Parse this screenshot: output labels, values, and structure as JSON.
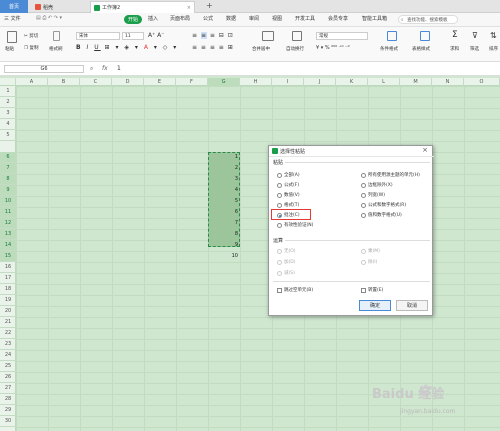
{
  "tabs": {
    "home": "首页",
    "doc": "稻壳",
    "book": "工作簿2"
  },
  "menu": {
    "file": "三 文件",
    "items": [
      "开始",
      "插入",
      "页面布局",
      "公式",
      "数据",
      "审阅",
      "视图",
      "开发工具",
      "会员专享",
      "智能工具箱"
    ],
    "search": "查找功能、搜索模板"
  },
  "toolbar": {
    "paste": "粘贴",
    "cut": "剪切",
    "copy": "复制",
    "format_painter": "格式刷",
    "font_name": "宋体",
    "font_size": "11",
    "merge": "合并居中",
    "wrap": "自动换行",
    "number_format": "常规",
    "cond_format": "条件格式",
    "table_style": "表格样式",
    "sum": "求和",
    "filter": "筛选",
    "sort": "排序"
  },
  "formula": {
    "cell": "G6",
    "fx": "fx",
    "value": "1"
  },
  "columns": [
    "A",
    "B",
    "C",
    "D",
    "E",
    "F",
    "G",
    "H",
    "I",
    "J",
    "K",
    "L",
    "M",
    "N",
    "O"
  ],
  "rows": [
    "1",
    "2",
    "3",
    "4",
    "5",
    "6",
    "7",
    "8",
    "9",
    "10",
    "11",
    "12",
    "13",
    "14",
    "15",
    "16",
    "17",
    "18",
    "19",
    "20",
    "21",
    "22",
    "23",
    "24",
    "25",
    "26",
    "27",
    "28",
    "29",
    "30",
    "31"
  ],
  "cells": [
    "1",
    "2",
    "3",
    "4",
    "5",
    "6",
    "7",
    "8",
    "9",
    "10"
  ],
  "dialog": {
    "title": "选择性粘贴",
    "paste_section": "粘贴",
    "left_opts": [
      "全部(A)",
      "公式(F)",
      "数值(V)",
      "格式(T)",
      "批注(C)",
      "有效性验证(N)"
    ],
    "right_opts": [
      "所有使用源主题的单元(H)",
      "边框除外(X)",
      "列宽(W)",
      "公式和数字格式(R)",
      "值和数字格式(U)"
    ],
    "op_section": "运算",
    "op_left": [
      "无(O)",
      "加(D)",
      "减(S)"
    ],
    "op_right": [
      "乘(M)",
      "除(I)"
    ],
    "skip_blanks": "跳过空单元(B)",
    "transpose": "转置(E)",
    "ok": "确定",
    "cancel": "取消"
  },
  "watermark": {
    "brand": "Baidu 经验",
    "url": "jingyan.baidu.com"
  }
}
